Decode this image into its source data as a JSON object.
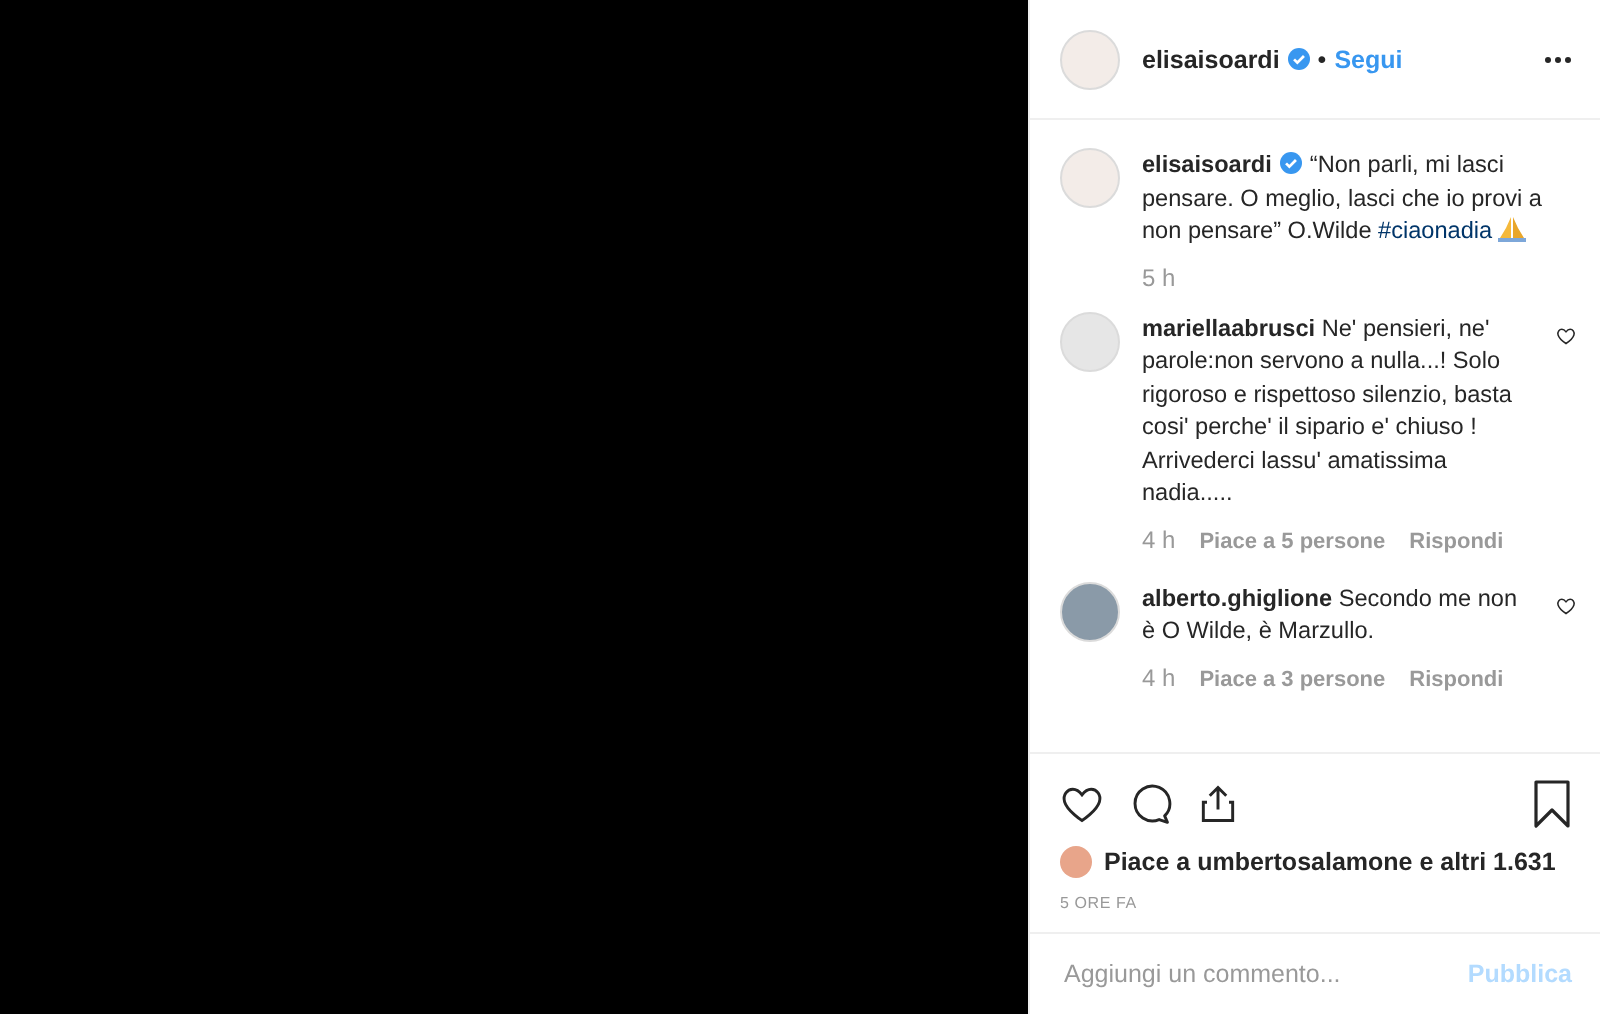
{
  "header": {
    "username": "elisaisoardi",
    "separator": "•",
    "follow_label": "Segui"
  },
  "caption": {
    "username": "elisaisoardi",
    "text": "“Non parli, mi lasci pensare. O meglio, lasci che io provi a non pensare” O.Wilde",
    "hashtag": "#ciaonadia",
    "time": "5 h"
  },
  "comments": [
    {
      "username": "mariellaabrusci",
      "text": "Ne' pensieri, ne' parole:non servono a nulla...! Solo rigoroso e rispettoso silenzio, basta cosi' perche' il sipario e' chiuso ! Arrivederci lassu' amatissima nadia.....",
      "time": "4 h",
      "likes": "Piace a 5 persone",
      "reply": "Rispondi"
    },
    {
      "username": "alberto.ghiglione",
      "text": "Secondo me non è O Wilde, è Marzullo.",
      "time": "4 h",
      "likes": "Piace a 3 persone",
      "reply": "Rispondi"
    }
  ],
  "likes_summary": "Piace a umbertosalamone e altri 1.631",
  "timestamp": "5 ORE FA",
  "comment_field": {
    "placeholder": "Aggiungi un commento..."
  },
  "post_button": {
    "label": "Pubblica",
    "disabled": true
  }
}
